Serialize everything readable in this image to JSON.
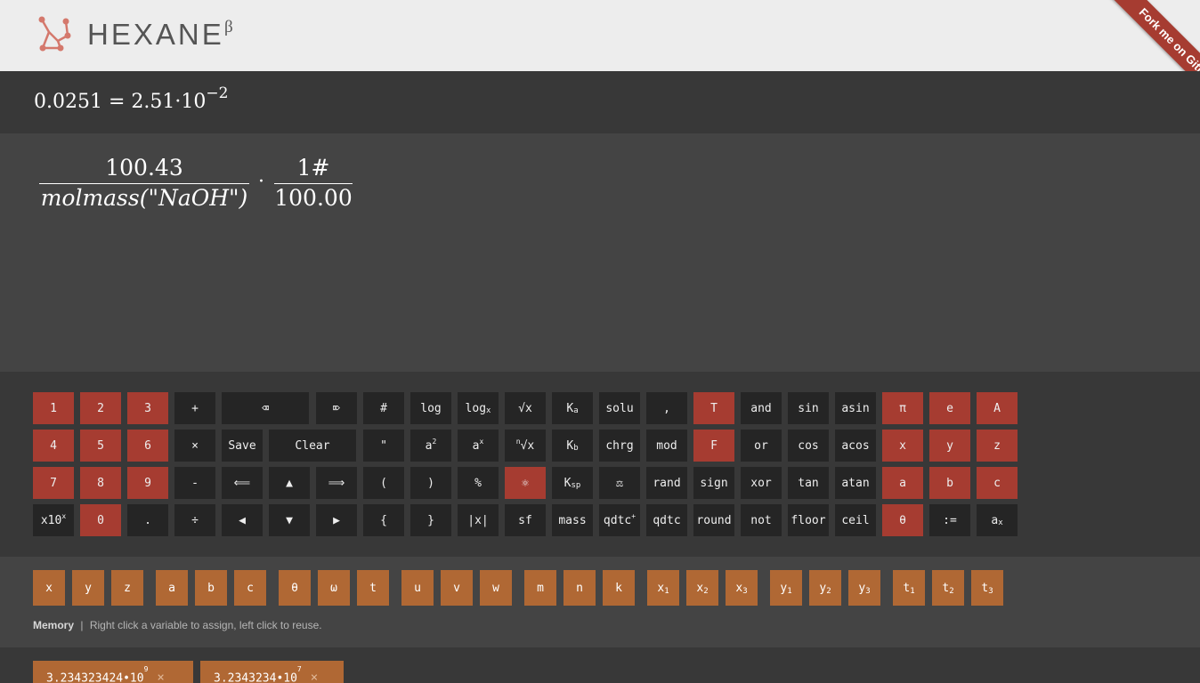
{
  "header": {
    "brand": "HEXANE",
    "brand_sup": "β",
    "ribbon": "Fork me on GitHub"
  },
  "result": {
    "lhs": "0.0251",
    "eq": "=",
    "mantissa": "2.51",
    "dot": "·",
    "base": "10",
    "exponent": "−2"
  },
  "expression": {
    "frac1_num": "100.43",
    "frac1_den": "molmass(\"NaOH\")",
    "op": "·",
    "frac2_num": "1#",
    "frac2_den": "100.00"
  },
  "keys": [
    {
      "label": "1",
      "sub": "",
      "sup": "",
      "pre": "",
      "color": "red"
    },
    {
      "label": "2",
      "sub": "",
      "sup": "",
      "pre": "",
      "color": "red"
    },
    {
      "label": "3",
      "sub": "",
      "sup": "",
      "pre": "",
      "color": "red"
    },
    {
      "label": "+",
      "sub": "",
      "sup": "",
      "pre": "",
      "color": "dark"
    },
    {
      "label": "⌫",
      "sub": "",
      "sup": "",
      "pre": "",
      "color": "dark"
    },
    {
      "label": "⌦",
      "sub": "",
      "sup": "",
      "pre": "",
      "color": "dark"
    },
    {
      "label": "#",
      "sub": "",
      "sup": "",
      "pre": "",
      "color": "dark"
    },
    {
      "label": "log",
      "sub": "",
      "sup": "",
      "pre": "",
      "color": "dark"
    },
    {
      "label": "log",
      "sub": "x",
      "sup": "",
      "pre": "",
      "color": "dark"
    },
    {
      "label": "√x",
      "sub": "",
      "sup": "",
      "pre": "",
      "color": "dark"
    },
    {
      "label": "K",
      "sub": "a",
      "sup": "",
      "pre": "",
      "color": "dark"
    },
    {
      "label": "solu",
      "sub": "",
      "sup": "",
      "pre": "",
      "color": "dark"
    },
    {
      "label": ",",
      "sub": "",
      "sup": "",
      "pre": "",
      "color": "dark"
    },
    {
      "label": "T",
      "sub": "",
      "sup": "",
      "pre": "",
      "color": "red"
    },
    {
      "label": "and",
      "sub": "",
      "sup": "",
      "pre": "",
      "color": "dark"
    },
    {
      "label": "sin",
      "sub": "",
      "sup": "",
      "pre": "",
      "color": "dark"
    },
    {
      "label": "asin",
      "sub": "",
      "sup": "",
      "pre": "",
      "color": "dark"
    },
    {
      "label": "π",
      "sub": "",
      "sup": "",
      "pre": "",
      "color": "red"
    },
    {
      "label": "e",
      "sub": "",
      "sup": "",
      "pre": "",
      "color": "red"
    },
    {
      "label": "A",
      "sub": "",
      "sup": "",
      "pre": "",
      "color": "red"
    },
    {
      "label": "4",
      "sub": "",
      "sup": "",
      "pre": "",
      "color": "red"
    },
    {
      "label": "5",
      "sub": "",
      "sup": "",
      "pre": "",
      "color": "red"
    },
    {
      "label": "6",
      "sub": "",
      "sup": "",
      "pre": "",
      "color": "red"
    },
    {
      "label": "×",
      "sub": "",
      "sup": "",
      "pre": "",
      "color": "dark"
    },
    {
      "label": "Save",
      "sub": "",
      "sup": "",
      "pre": "",
      "color": "dark"
    },
    {
      "label": "Clear",
      "sub": "",
      "sup": "",
      "pre": "",
      "color": "dark"
    },
    {
      "label": "\"",
      "sub": "",
      "sup": "",
      "pre": "",
      "color": "dark"
    },
    {
      "label": "a",
      "sub": "",
      "sup": "2",
      "pre": "",
      "color": "dark"
    },
    {
      "label": "a",
      "sub": "",
      "sup": "x",
      "pre": "",
      "color": "dark"
    },
    {
      "label": "√x",
      "sub": "",
      "sup": "",
      "pre": "n",
      "color": "dark"
    },
    {
      "label": "K",
      "sub": "b",
      "sup": "",
      "pre": "",
      "color": "dark"
    },
    {
      "label": "chrg",
      "sub": "",
      "sup": "",
      "pre": "",
      "color": "dark"
    },
    {
      "label": "mod",
      "sub": "",
      "sup": "",
      "pre": "",
      "color": "dark"
    },
    {
      "label": "F",
      "sub": "",
      "sup": "",
      "pre": "",
      "color": "red"
    },
    {
      "label": "or",
      "sub": "",
      "sup": "",
      "pre": "",
      "color": "dark"
    },
    {
      "label": "cos",
      "sub": "",
      "sup": "",
      "pre": "",
      "color": "dark"
    },
    {
      "label": "acos",
      "sub": "",
      "sup": "",
      "pre": "",
      "color": "dark"
    },
    {
      "label": "x",
      "sub": "",
      "sup": "",
      "pre": "",
      "color": "red"
    },
    {
      "label": "y",
      "sub": "",
      "sup": "",
      "pre": "",
      "color": "red"
    },
    {
      "label": "z",
      "sub": "",
      "sup": "",
      "pre": "",
      "color": "red"
    },
    {
      "label": "7",
      "sub": "",
      "sup": "",
      "pre": "",
      "color": "red"
    },
    {
      "label": "8",
      "sub": "",
      "sup": "",
      "pre": "",
      "color": "red"
    },
    {
      "label": "9",
      "sub": "",
      "sup": "",
      "pre": "",
      "color": "red"
    },
    {
      "label": "-",
      "sub": "",
      "sup": "",
      "pre": "",
      "color": "dark"
    },
    {
      "label": "⟸",
      "sub": "",
      "sup": "",
      "pre": "",
      "color": "dark"
    },
    {
      "label": "▲",
      "sub": "",
      "sup": "",
      "pre": "",
      "color": "dark"
    },
    {
      "label": "⟹",
      "sub": "",
      "sup": "",
      "pre": "",
      "color": "dark"
    },
    {
      "label": "(",
      "sub": "",
      "sup": "",
      "pre": "",
      "color": "dark"
    },
    {
      "label": ")",
      "sub": "",
      "sup": "",
      "pre": "",
      "color": "dark"
    },
    {
      "label": "%",
      "sub": "",
      "sup": "",
      "pre": "",
      "color": "dark"
    },
    {
      "label": "⚛",
      "sub": "",
      "sup": "",
      "pre": "",
      "color": "red"
    },
    {
      "label": "K",
      "sub": "sp",
      "sup": "",
      "pre": "",
      "color": "dark"
    },
    {
      "label": "⚖",
      "sub": "",
      "sup": "",
      "pre": "",
      "color": "dark"
    },
    {
      "label": "rand",
      "sub": "",
      "sup": "",
      "pre": "",
      "color": "dark"
    },
    {
      "label": "sign",
      "sub": "",
      "sup": "",
      "pre": "",
      "color": "dark"
    },
    {
      "label": "xor",
      "sub": "",
      "sup": "",
      "pre": "",
      "color": "dark"
    },
    {
      "label": "tan",
      "sub": "",
      "sup": "",
      "pre": "",
      "color": "dark"
    },
    {
      "label": "atan",
      "sub": "",
      "sup": "",
      "pre": "",
      "color": "dark"
    },
    {
      "label": "a",
      "sub": "",
      "sup": "",
      "pre": "",
      "color": "red"
    },
    {
      "label": "b",
      "sub": "",
      "sup": "",
      "pre": "",
      "color": "red"
    },
    {
      "label": "c",
      "sub": "",
      "sup": "",
      "pre": "",
      "color": "red"
    },
    {
      "label": "x10",
      "sub": "",
      "sup": "x",
      "pre": "",
      "color": "dark"
    },
    {
      "label": "0",
      "sub": "",
      "sup": "",
      "pre": "",
      "color": "red"
    },
    {
      "label": ".",
      "sub": "",
      "sup": "",
      "pre": "",
      "color": "dark"
    },
    {
      "label": "÷",
      "sub": "",
      "sup": "",
      "pre": "",
      "color": "dark"
    },
    {
      "label": "◀",
      "sub": "",
      "sup": "",
      "pre": "",
      "color": "dark"
    },
    {
      "label": "▼",
      "sub": "",
      "sup": "",
      "pre": "",
      "color": "dark"
    },
    {
      "label": "▶",
      "sub": "",
      "sup": "",
      "pre": "",
      "color": "dark"
    },
    {
      "label": "{",
      "sub": "",
      "sup": "",
      "pre": "",
      "color": "dark"
    },
    {
      "label": "}",
      "sub": "",
      "sup": "",
      "pre": "",
      "color": "dark"
    },
    {
      "label": "|x|",
      "sub": "",
      "sup": "",
      "pre": "",
      "color": "dark"
    },
    {
      "label": "sf",
      "sub": "",
      "sup": "",
      "pre": "",
      "color": "dark"
    },
    {
      "label": "mass",
      "sub": "",
      "sup": "",
      "pre": "",
      "color": "dark"
    },
    {
      "label": "qdtc",
      "sub": "",
      "sup": "+",
      "pre": "",
      "color": "dark"
    },
    {
      "label": "qdtc",
      "sub": "",
      "sup": "",
      "pre": "",
      "color": "dark"
    },
    {
      "label": "round",
      "sub": "",
      "sup": "",
      "pre": "",
      "color": "dark"
    },
    {
      "label": "not",
      "sub": "",
      "sup": "",
      "pre": "",
      "color": "dark"
    },
    {
      "label": "floor",
      "sub": "",
      "sup": "",
      "pre": "",
      "color": "dark"
    },
    {
      "label": "ceil",
      "sub": "",
      "sup": "",
      "pre": "",
      "color": "dark"
    },
    {
      "label": "θ",
      "sub": "",
      "sup": "",
      "pre": "",
      "color": "red"
    },
    {
      "label": ":=",
      "sub": "",
      "sup": "",
      "pre": "",
      "color": "dark"
    },
    {
      "label": "a",
      "sub": "x",
      "sup": "",
      "pre": "",
      "color": "dark"
    }
  ],
  "variables": [
    {
      "label": "x",
      "sub": ""
    },
    {
      "label": "y",
      "sub": ""
    },
    {
      "label": "z",
      "sub": ""
    },
    {
      "label": "a",
      "sub": ""
    },
    {
      "label": "b",
      "sub": ""
    },
    {
      "label": "c",
      "sub": ""
    },
    {
      "label": "θ",
      "sub": ""
    },
    {
      "label": "ω",
      "sub": ""
    },
    {
      "label": "t",
      "sub": ""
    },
    {
      "label": "u",
      "sub": ""
    },
    {
      "label": "v",
      "sub": ""
    },
    {
      "label": "w",
      "sub": ""
    },
    {
      "label": "m",
      "sub": ""
    },
    {
      "label": "n",
      "sub": ""
    },
    {
      "label": "k",
      "sub": ""
    },
    {
      "label": "x",
      "sub": "1"
    },
    {
      "label": "x",
      "sub": "2"
    },
    {
      "label": "x",
      "sub": "3"
    },
    {
      "label": "y",
      "sub": "1"
    },
    {
      "label": "y",
      "sub": "2"
    },
    {
      "label": "y",
      "sub": "3"
    },
    {
      "label": "t",
      "sub": "1"
    },
    {
      "label": "t",
      "sub": "2"
    },
    {
      "label": "t",
      "sub": "3"
    }
  ],
  "memory": {
    "title": "Memory",
    "separator": "|",
    "hint": "Right click a variable to assign, left click to reuse.",
    "items": [
      {
        "value": "3.234323424•10",
        "exp": "9",
        "close": "×"
      },
      {
        "value": "3.2343234•10",
        "exp": "7",
        "close": "×"
      }
    ]
  },
  "colors": {
    "accent_red": "#a63c31",
    "accent_orange": "#b06834",
    "key_dark": "#252525"
  }
}
